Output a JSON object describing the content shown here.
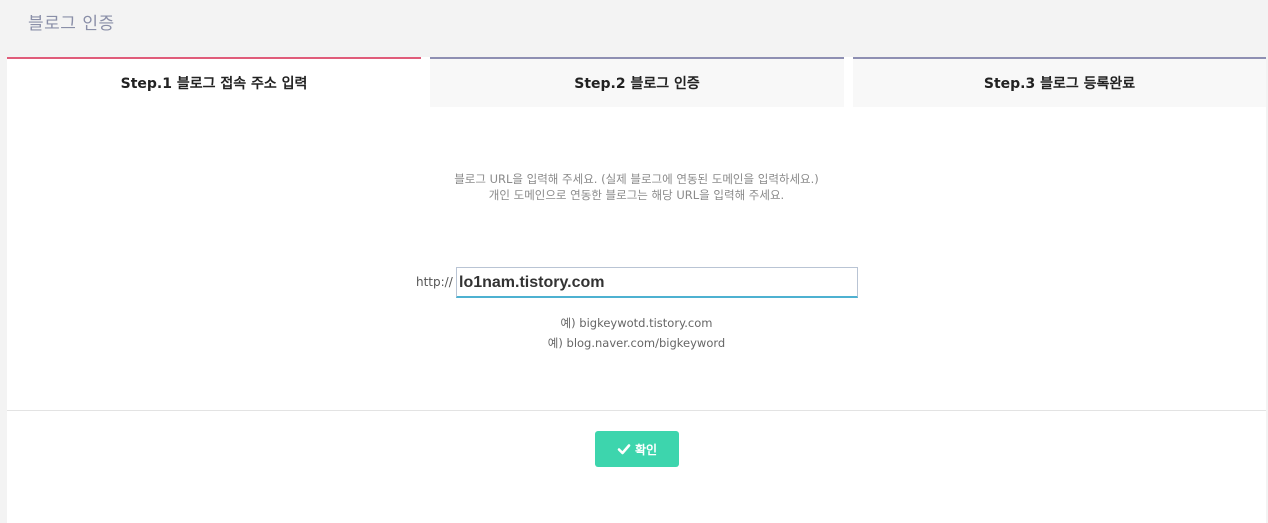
{
  "header": {
    "title": "블로그 인증"
  },
  "tabs": [
    {
      "label": "Step.1 블로그 접속 주소 입력",
      "active": true
    },
    {
      "label": "Step.2 블로그 인증",
      "active": false
    },
    {
      "label": "Step.3 블로그 등록완료",
      "active": false
    }
  ],
  "instructions": {
    "line1": "블로그 URL을 입력해 주세요. (실제 블로그에 연동된 도메인을 입력하세요.)",
    "line2": "개인 도메인으로 연동한 블로그는 해당 URL을 입력해 주세요."
  },
  "url_form": {
    "prefix": "http://",
    "value": "lo1nam.tistory.com"
  },
  "examples": [
    "예) bigkeywotd.tistory.com",
    "예) blog.naver.com/bigkeyword"
  ],
  "confirm": {
    "label": "확인",
    "icon": "check-icon"
  },
  "colors": {
    "active_tab_accent": "#e05c7a",
    "inactive_tab_accent": "#8e8fb2",
    "confirm_button": "#3dd5ad",
    "input_focus": "#4eb1d1"
  }
}
